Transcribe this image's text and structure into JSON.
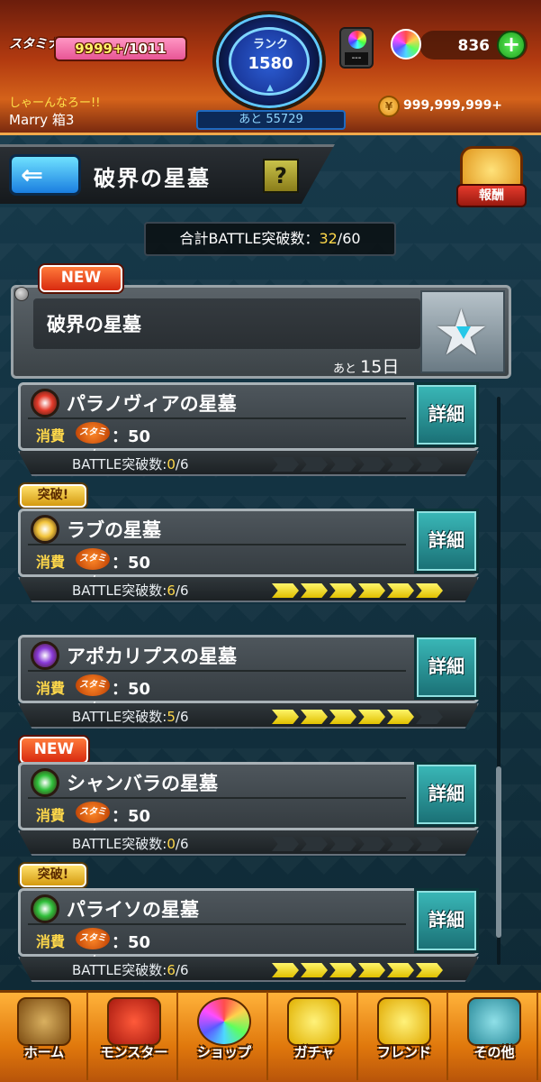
{
  "header": {
    "stamina_label": "スタミナ",
    "stamina_current": "9999+",
    "stamina_max": "/1011",
    "greeting": "しゃーんなろー!!",
    "username": "Marry 箱3",
    "rank_label": "ランク",
    "rank_value": "1580",
    "rank_next": "あと 55729",
    "machine_value": "---",
    "orb_count": "836",
    "plus_label": "+",
    "gold_count": "999,999,999+"
  },
  "titlebar": {
    "back_arrow": "⇐",
    "title": "破界の星墓",
    "help_label": "?",
    "reward_label": "報酬"
  },
  "total": {
    "label": "合計BATTLE突破数：",
    "current": "32",
    "total": "/60"
  },
  "event": {
    "tag": "NEW",
    "title": "破界の星墓",
    "remaining_prefix": "あと",
    "remaining_value": "15日"
  },
  "quests": [
    {
      "tag": "",
      "name": "パラノヴィアの星墓",
      "element_color": "#e33a2a",
      "cost_label": "消費",
      "stamina_icon": "スタミナ",
      "cost": "：50",
      "progress_label": "BATTLE突破数:",
      "progress_current": "0",
      "progress_total": "/6",
      "progress": 0,
      "detail": "詳細"
    },
    {
      "tag": "突破!",
      "name": "ラブの星墓",
      "element_color": "#f2c43a",
      "cost_label": "消費",
      "stamina_icon": "スタミナ",
      "cost": "：50",
      "progress_label": "BATTLE突破数:",
      "progress_current": "6",
      "progress_total": "/6",
      "progress": 6,
      "detail": "詳細"
    },
    {
      "tag": "",
      "name": "アポカリプスの星墓",
      "element_color": "#8a3ad8",
      "cost_label": "消費",
      "stamina_icon": "スタミナ",
      "cost": "：50",
      "progress_label": "BATTLE突破数:",
      "progress_current": "5",
      "progress_total": "/6",
      "progress": 5,
      "detail": "詳細"
    },
    {
      "tag": "NEW",
      "name": "シャンバラの星墓",
      "element_color": "#2fbf3a",
      "cost_label": "消費",
      "stamina_icon": "スタミナ",
      "cost": "：50",
      "progress_label": "BATTLE突破数:",
      "progress_current": "0",
      "progress_total": "/6",
      "progress": 0,
      "detail": "詳細"
    },
    {
      "tag": "突破!",
      "name": "パライソの星墓",
      "element_color": "#2fbf3a",
      "cost_label": "消費",
      "stamina_icon": "スタミナ",
      "cost": "：50",
      "progress_label": "BATTLE突破数:",
      "progress_current": "6",
      "progress_total": "/6",
      "progress": 6,
      "detail": "詳細"
    }
  ],
  "nav": [
    {
      "label": "ホーム",
      "icon": "home-gate-icon"
    },
    {
      "label": "モンスター",
      "icon": "monster-icon"
    },
    {
      "label": "ショップ",
      "icon": "orb-shop-icon"
    },
    {
      "label": "ガチャ",
      "icon": "gacha-egg-icon"
    },
    {
      "label": "フレンド",
      "icon": "friend-icon"
    },
    {
      "label": "その他",
      "icon": "other-icon"
    }
  ]
}
